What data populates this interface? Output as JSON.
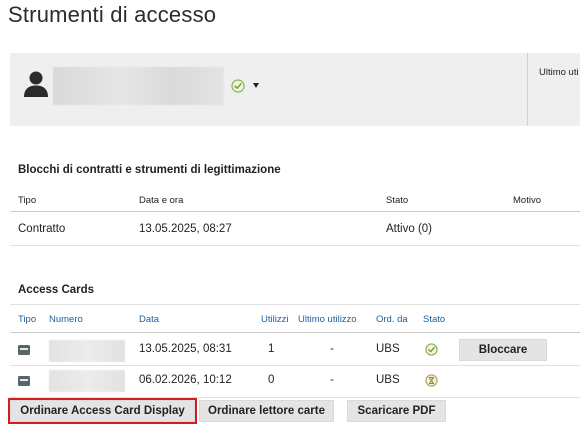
{
  "page": {
    "title": "Strumenti di accesso"
  },
  "user_panel": {
    "status_icon": "check-circle-icon",
    "last_label": "Ultimo uti",
    "colors": {
      "background": "#efefef",
      "status_ok": "#8bb346"
    }
  },
  "contracts": {
    "title": "Blocchi di contratti e strumenti di legittimazione",
    "headers": {
      "tipo": "Tipo",
      "data": "Data e ora",
      "stato": "Stato",
      "motivo": "Motivo"
    },
    "rows": [
      {
        "tipo": "Contratto",
        "data": "13.05.2025, 08:27",
        "stato": "Attivo (0)",
        "motivo": ""
      }
    ]
  },
  "access_cards": {
    "title": "Access Cards",
    "headers": {
      "tipo": "Tipo",
      "numero": "Numero",
      "data": "Data",
      "utilizzi": "Utilizzi",
      "ultimo": "Ultimo utilizzo",
      "ord": "Ord. da",
      "stato": "Stato"
    },
    "rows": [
      {
        "data": "13.05.2025, 08:31",
        "utilizzi": "1",
        "ultimo": "-",
        "ord": "UBS",
        "stato_icon": "check-circle-icon",
        "action": "Bloccare"
      },
      {
        "data": "06.02.2026, 10:12",
        "utilizzi": "0",
        "ultimo": "-",
        "ord": "UBS",
        "stato_icon": "hourglass-icon",
        "action": ""
      }
    ]
  },
  "actions": {
    "order_display": "Ordinare Access Card Display",
    "order_reader": "Ordinare lettore carte",
    "download_pdf": "Scaricare PDF",
    "highlight_color": "#d11f1f"
  }
}
